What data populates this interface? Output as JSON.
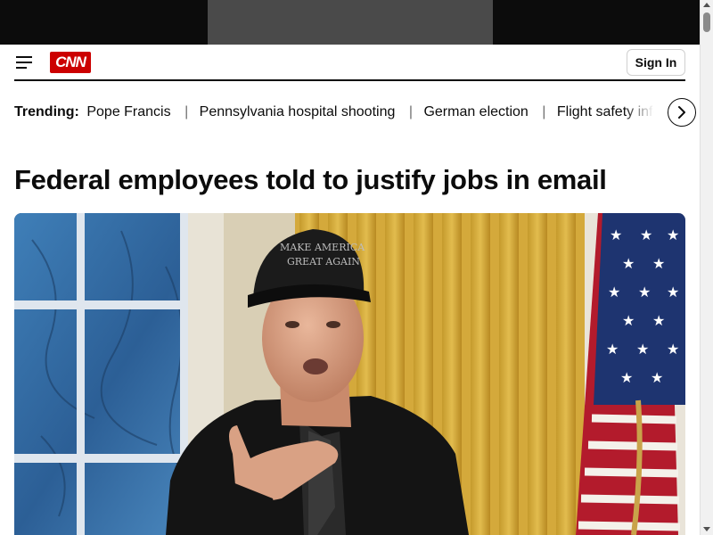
{
  "header": {
    "logo_text": "CNN",
    "signin_label": "Sign In"
  },
  "trending": {
    "label": "Trending:",
    "items": [
      "Pope Francis",
      "Pennsylvania hospital shooting",
      "German election",
      "Flight safety infor"
    ],
    "separator": "|"
  },
  "article": {
    "headline": "Federal employees told to justify jobs in email"
  },
  "hero_image": {
    "cap_text_line1": "MAKE AMERICA",
    "cap_text_line2": "GREAT AGAIN"
  },
  "colors": {
    "brand_red": "#cc0000",
    "ad_bar": "#0c0c0c",
    "ad_slot": "#4a4a4a"
  },
  "icons": {
    "menu": "hamburger-menu-icon",
    "next": "chevron-right-icon"
  }
}
